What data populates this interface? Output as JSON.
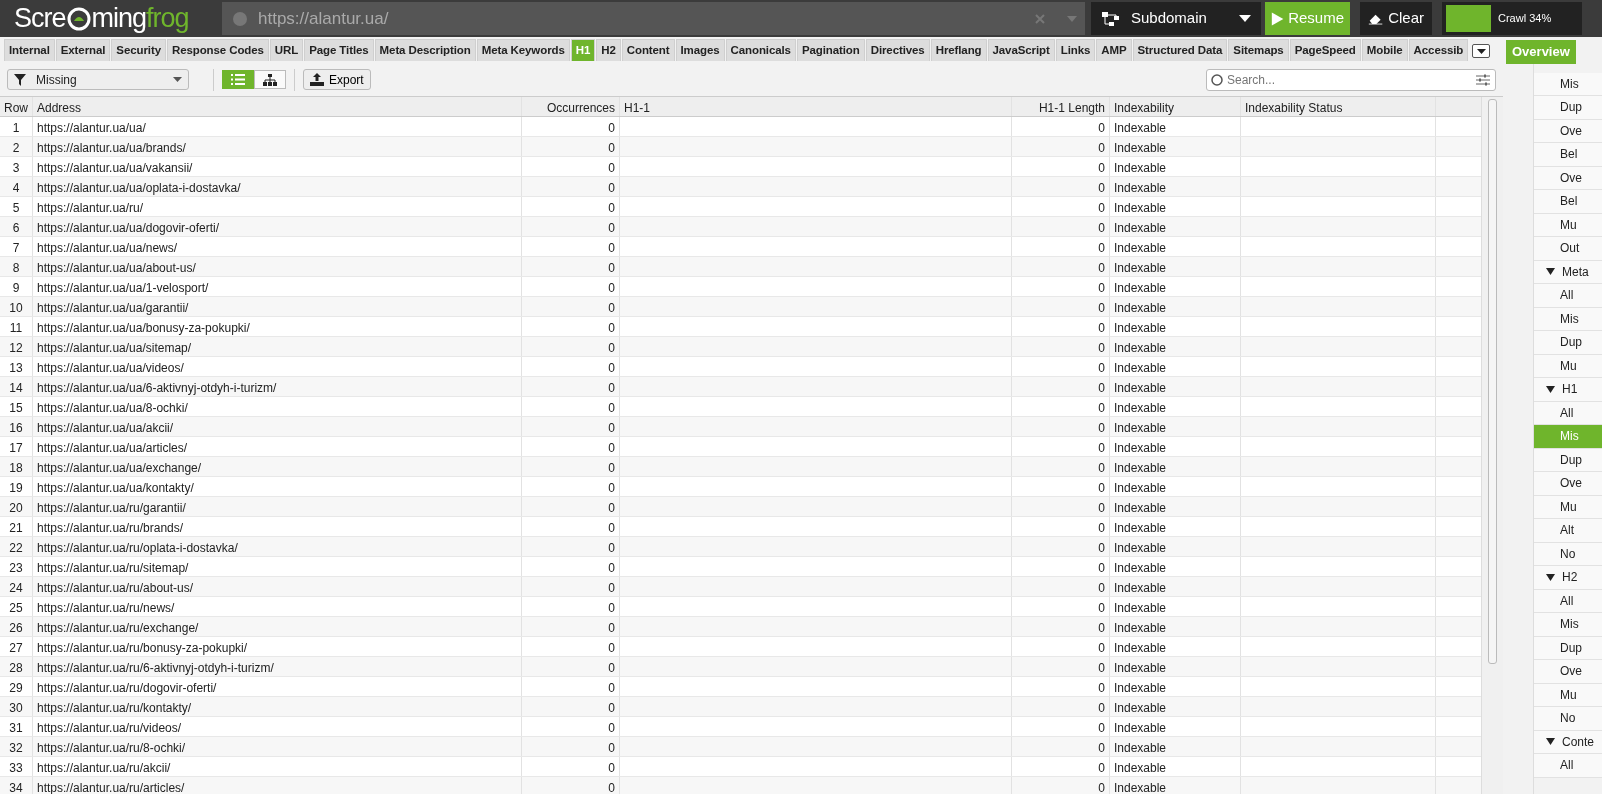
{
  "logo": {
    "part_1": "Scre",
    "part_2": "ming",
    "part_3": "frog"
  },
  "url_field": {
    "value": "https://alantur.ua/"
  },
  "mode_dropdown": {
    "label": "Subdomain"
  },
  "buttons": [
    {
      "kind": "resume",
      "label": "Resume"
    },
    {
      "kind": "clear",
      "label": "Clear"
    }
  ],
  "crawl_progress": {
    "label": "Crawl 34%",
    "level": 0.34
  },
  "tabs": [
    {
      "label": "Internal",
      "selected": false
    },
    {
      "label": "External",
      "selected": false
    },
    {
      "label": "Security",
      "selected": false
    },
    {
      "label": "Response Codes",
      "selected": false
    },
    {
      "label": "URL",
      "selected": false
    },
    {
      "label": "Page Titles",
      "selected": false
    },
    {
      "label": "Meta Description",
      "selected": false
    },
    {
      "label": "Meta Keywords",
      "selected": false
    },
    {
      "label": "H1",
      "selected": true
    },
    {
      "label": "H2",
      "selected": false
    },
    {
      "label": "Content",
      "selected": false
    },
    {
      "label": "Images",
      "selected": false
    },
    {
      "label": "Canonicals",
      "selected": false
    },
    {
      "label": "Pagination",
      "selected": false
    },
    {
      "label": "Directives",
      "selected": false
    },
    {
      "label": "Hreflang",
      "selected": false
    },
    {
      "label": "JavaScript",
      "selected": false
    },
    {
      "label": "Links",
      "selected": false
    },
    {
      "label": "AMP",
      "selected": false
    },
    {
      "label": "Structured Data",
      "selected": false
    },
    {
      "label": "Sitemaps",
      "selected": false
    },
    {
      "label": "PageSpeed",
      "selected": false
    },
    {
      "label": "Mobile",
      "selected": false
    },
    {
      "label": "Accessib",
      "selected": false
    }
  ],
  "side_tabs": [
    {
      "label": "Overview",
      "selected": true
    }
  ],
  "filter": {
    "value": "Missing"
  },
  "view_toggle": [
    {
      "kind": "list",
      "selected": true
    },
    {
      "kind": "tree",
      "selected": false
    }
  ],
  "export_button": {
    "label": "Export"
  },
  "search": {
    "placeholder": "Search..."
  },
  "table": {
    "columns": [
      "Row",
      "Address",
      "Occurrences",
      "H1-1",
      "H1-1 Length",
      "Indexability",
      "Indexability Status"
    ],
    "rows": [
      [
        "1",
        "https://alantur.ua/ua/",
        "0",
        "",
        "0",
        "Indexable"
      ],
      [
        "2",
        "https://alantur.ua/ua/brands/",
        "0",
        "",
        "0",
        "Indexable"
      ],
      [
        "3",
        "https://alantur.ua/ua/vakansii/",
        "0",
        "",
        "0",
        "Indexable"
      ],
      [
        "4",
        "https://alantur.ua/ua/oplata-i-dostavka/",
        "0",
        "",
        "0",
        "Indexable"
      ],
      [
        "5",
        "https://alantur.ua/ru/",
        "0",
        "",
        "0",
        "Indexable"
      ],
      [
        "6",
        "https://alantur.ua/ua/dogovir-oferti/",
        "0",
        "",
        "0",
        "Indexable"
      ],
      [
        "7",
        "https://alantur.ua/ua/news/",
        "0",
        "",
        "0",
        "Indexable"
      ],
      [
        "8",
        "https://alantur.ua/ua/about-us/",
        "0",
        "",
        "0",
        "Indexable"
      ],
      [
        "9",
        "https://alantur.ua/ua/1-velosport/",
        "0",
        "",
        "0",
        "Indexable"
      ],
      [
        "10",
        "https://alantur.ua/ua/garantii/",
        "0",
        "",
        "0",
        "Indexable"
      ],
      [
        "11",
        "https://alantur.ua/ua/bonusy-za-pokupki/",
        "0",
        "",
        "0",
        "Indexable"
      ],
      [
        "12",
        "https://alantur.ua/ua/sitemap/",
        "0",
        "",
        "0",
        "Indexable"
      ],
      [
        "13",
        "https://alantur.ua/ua/videos/",
        "0",
        "",
        "0",
        "Indexable"
      ],
      [
        "14",
        "https://alantur.ua/ua/6-aktivnyj-otdyh-i-turizm/",
        "0",
        "",
        "0",
        "Indexable"
      ],
      [
        "15",
        "https://alantur.ua/ua/8-ochki/",
        "0",
        "",
        "0",
        "Indexable"
      ],
      [
        "16",
        "https://alantur.ua/ua/akcii/",
        "0",
        "",
        "0",
        "Indexable"
      ],
      [
        "17",
        "https://alantur.ua/ua/articles/",
        "0",
        "",
        "0",
        "Indexable"
      ],
      [
        "18",
        "https://alantur.ua/ua/exchange/",
        "0",
        "",
        "0",
        "Indexable"
      ],
      [
        "19",
        "https://alantur.ua/ua/kontakty/",
        "0",
        "",
        "0",
        "Indexable"
      ],
      [
        "20",
        "https://alantur.ua/ru/garantii/",
        "0",
        "",
        "0",
        "Indexable"
      ],
      [
        "21",
        "https://alantur.ua/ru/brands/",
        "0",
        "",
        "0",
        "Indexable"
      ],
      [
        "22",
        "https://alantur.ua/ru/oplata-i-dostavka/",
        "0",
        "",
        "0",
        "Indexable"
      ],
      [
        "23",
        "https://alantur.ua/ru/sitemap/",
        "0",
        "",
        "0",
        "Indexable"
      ],
      [
        "24",
        "https://alantur.ua/ru/about-us/",
        "0",
        "",
        "0",
        "Indexable"
      ],
      [
        "25",
        "https://alantur.ua/ru/news/",
        "0",
        "",
        "0",
        "Indexable"
      ],
      [
        "26",
        "https://alantur.ua/ru/exchange/",
        "0",
        "",
        "0",
        "Indexable"
      ],
      [
        "27",
        "https://alantur.ua/ru/bonusy-za-pokupki/",
        "0",
        "",
        "0",
        "Indexable"
      ],
      [
        "28",
        "https://alantur.ua/ru/6-aktivnyj-otdyh-i-turizm/",
        "0",
        "",
        "0",
        "Indexable"
      ],
      [
        "29",
        "https://alantur.ua/ru/dogovir-oferti/",
        "0",
        "",
        "0",
        "Indexable"
      ],
      [
        "30",
        "https://alantur.ua/ru/kontakty/",
        "0",
        "",
        "0",
        "Indexable"
      ],
      [
        "31",
        "https://alantur.ua/ru/videos/",
        "0",
        "",
        "0",
        "Indexable"
      ],
      [
        "32",
        "https://alantur.ua/ru/8-ochki/",
        "0",
        "",
        "0",
        "Indexable"
      ],
      [
        "33",
        "https://alantur.ua/ru/akcii/",
        "0",
        "",
        "0",
        "Indexable"
      ],
      [
        "34",
        "https://alantur.ua/ru/articles/",
        "0",
        "",
        "0",
        "Indexable"
      ]
    ]
  },
  "overview_tree": [
    {
      "label": "Mis",
      "selected": false
    },
    {
      "label": "Dup",
      "selected": false
    },
    {
      "label": "Ove",
      "selected": false
    },
    {
      "label": "Bel",
      "selected": false
    },
    {
      "label": "Ove",
      "selected": false
    },
    {
      "label": "Bel",
      "selected": false
    },
    {
      "label": "Mu",
      "selected": false
    },
    {
      "label": "Out",
      "selected": false
    },
    {
      "label": "Meta",
      "expanded": true,
      "children": [
        {
          "label": "All",
          "selected": false
        },
        {
          "label": "Mis",
          "selected": false
        },
        {
          "label": "Dup",
          "selected": false
        },
        {
          "label": "Mu",
          "selected": false
        }
      ]
    },
    {
      "label": "H1",
      "expanded": true,
      "children": [
        {
          "label": "All",
          "selected": false
        },
        {
          "label": "Mis",
          "selected": true
        },
        {
          "label": "Dup",
          "selected": false
        },
        {
          "label": "Ove",
          "selected": false
        },
        {
          "label": "Mu",
          "selected": false
        },
        {
          "label": "Alt",
          "selected": false
        },
        {
          "label": "No",
          "selected": false
        }
      ]
    },
    {
      "label": "H2",
      "expanded": true,
      "children": [
        {
          "label": "All",
          "selected": false
        },
        {
          "label": "Mis",
          "selected": false
        },
        {
          "label": "Dup",
          "selected": false
        },
        {
          "label": "Ove",
          "selected": false
        },
        {
          "label": "Mu",
          "selected": false
        },
        {
          "label": "No",
          "selected": false
        }
      ]
    },
    {
      "label": "Conte",
      "expanded": true,
      "children": [
        {
          "label": "All",
          "selected": false
        }
      ]
    }
  ]
}
